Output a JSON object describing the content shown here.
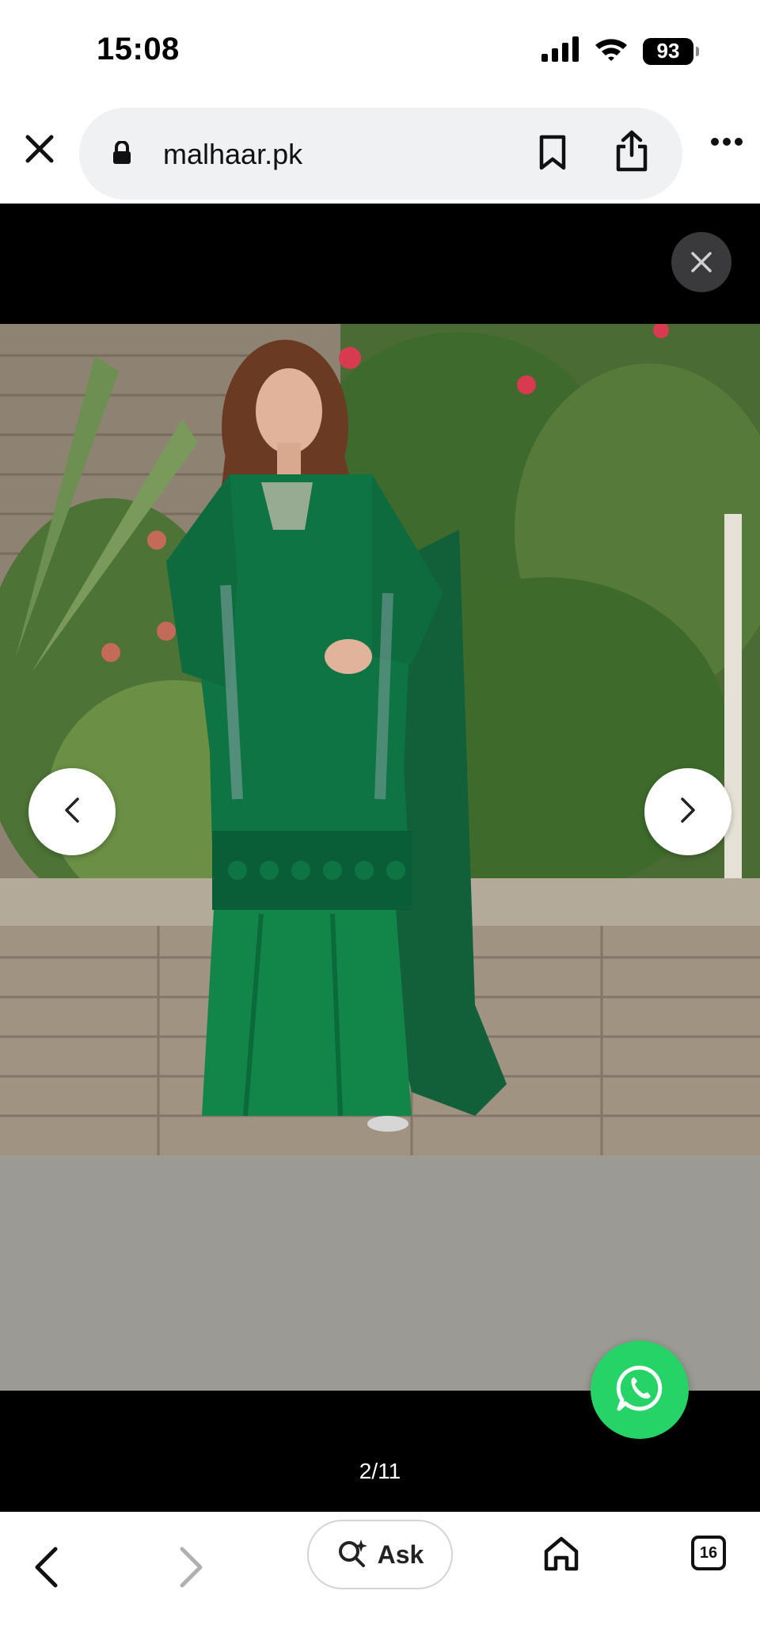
{
  "status_bar": {
    "time": "15:08",
    "battery": "93",
    "icons": [
      "signal-icon",
      "wifi-icon",
      "battery-icon"
    ]
  },
  "browser": {
    "url": "malhaar.pk",
    "icons": [
      "close-icon",
      "lock-icon",
      "bookmark-icon",
      "share-icon",
      "more-icon"
    ]
  },
  "gallery": {
    "counter": "2/11",
    "icons": [
      "close-icon",
      "chevron-left-icon",
      "chevron-right-icon",
      "whatsapp-icon"
    ],
    "photo_subject": "model wearing embroidered emerald green kurta with dupatta and sharara"
  },
  "bottom_bar": {
    "ask_label": "Ask",
    "tabs_count": "16",
    "icons": [
      "back-icon",
      "forward-icon",
      "ask-search-icon",
      "home-icon",
      "tabs-icon"
    ]
  },
  "colors": {
    "whatsapp_green": "#25d366",
    "viewer_bg": "#000000",
    "url_pill_bg": "#f0f1f3"
  }
}
